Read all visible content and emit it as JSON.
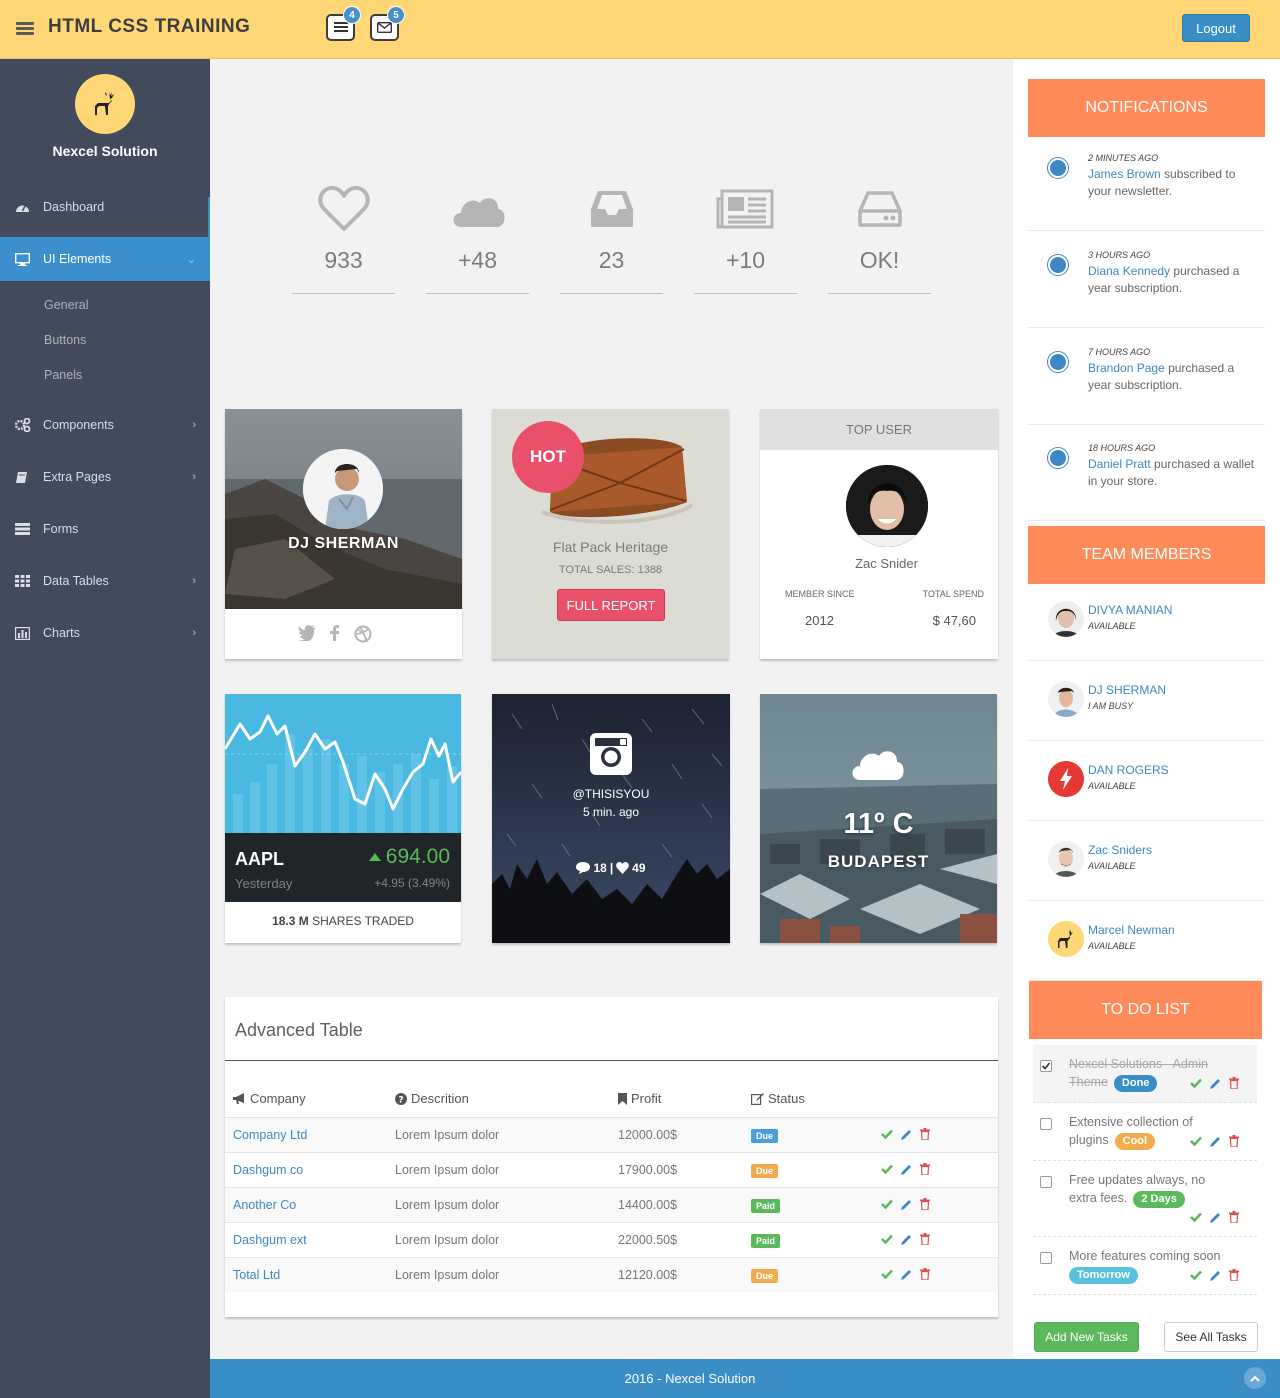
{
  "header": {
    "title": "HTML CSS TRAINING",
    "tasks_badge": "4",
    "mail_badge": "5",
    "logout_label": "Logout"
  },
  "sidebar": {
    "profile_name": "Nexcel Solution",
    "items": [
      {
        "label": "Dashboard",
        "icon": "dashboard-icon"
      },
      {
        "label": "UI Elements",
        "icon": "desktop-icon"
      },
      {
        "label": "Components",
        "icon": "cogs-icon"
      },
      {
        "label": "Extra Pages",
        "icon": "book-icon"
      },
      {
        "label": "Forms",
        "icon": "tasks-icon"
      },
      {
        "label": "Data Tables",
        "icon": "table-icon"
      },
      {
        "label": "Charts",
        "icon": "bar-chart-icon"
      }
    ],
    "subitems": [
      "General",
      "Buttons",
      "Panels"
    ]
  },
  "stats": [
    {
      "icon": "heart-icon",
      "value": "933"
    },
    {
      "icon": "cloud-icon",
      "value": "+48"
    },
    {
      "icon": "inbox-icon",
      "value": "23"
    },
    {
      "icon": "newspaper-icon",
      "value": "+10"
    },
    {
      "icon": "hdd-icon",
      "value": "OK!"
    }
  ],
  "profile_card": {
    "name": "DJ SHERMAN"
  },
  "product_card": {
    "badge": "HOT",
    "title": "Flat Pack Heritage",
    "sales": "TOTAL SALES: 1388",
    "button": "FULL REPORT"
  },
  "top_user": {
    "header": "TOP USER",
    "name": "Zac Snider",
    "member_since_label": "MEMBER SINCE",
    "member_since": "2012",
    "total_spend_label": "TOTAL SPEND",
    "total_spend": "$ 47,60"
  },
  "stock": {
    "symbol": "AAPL",
    "price": "694.00",
    "period": "Yesterday",
    "change": "+4.95 (3.49%)",
    "shares_value": "18.3 M",
    "shares_label": "SHARES TRADED"
  },
  "instagram": {
    "handle": "@THISISYOU",
    "time": "5 min. ago",
    "comments": "18",
    "likes": "49"
  },
  "weather": {
    "temp": "11º C",
    "city": "BUDAPEST"
  },
  "table": {
    "title": "Advanced Table",
    "headers": [
      "Company",
      "Descrition",
      "Profit",
      "Status"
    ],
    "rows": [
      {
        "company": "Company Ltd",
        "desc": "Lorem Ipsum dolor",
        "profit": "12000.00$",
        "status": "Due"
      },
      {
        "company": "Dashgum co",
        "desc": "Lorem Ipsum dolor",
        "profit": "17900.00$",
        "status": "Due"
      },
      {
        "company": "Another Co",
        "desc": "Lorem Ipsum dolor",
        "profit": "14400.00$",
        "status": "Paid"
      },
      {
        "company": "Dashgum ext",
        "desc": "Lorem Ipsum dolor",
        "profit": "22000.50$",
        "status": "Paid"
      },
      {
        "company": "Total Ltd",
        "desc": "Lorem Ipsum dolor",
        "profit": "12120.00$",
        "status": "Due"
      }
    ]
  },
  "notifications": {
    "title": "NOTIFICATIONS",
    "items": [
      {
        "time": "2 MINUTES AGO",
        "who": "James Brown",
        "text": "subscribed to your newsletter."
      },
      {
        "time": "3 HOURS AGO",
        "who": "Diana Kennedy",
        "text": "purchased a year subscription."
      },
      {
        "time": "7 HOURS AGO",
        "who": "Brandon Page",
        "text": "purchased a year subscription."
      },
      {
        "time": "18 HOURS AGO",
        "who": "Daniel Pratt",
        "text": "purchased a wallet in your store."
      }
    ]
  },
  "team": {
    "title": "TEAM MEMBERS",
    "members": [
      {
        "name": "DIVYA MANIAN",
        "status": "AVAILABLE"
      },
      {
        "name": "DJ SHERMAN",
        "status": "I AM BUSY"
      },
      {
        "name": "DAN ROGERS",
        "status": "AVAILABLE"
      },
      {
        "name": "Zac Sniders",
        "status": "AVAILABLE"
      },
      {
        "name": "Marcel Newman",
        "status": "AVAILABLE"
      }
    ]
  },
  "todo": {
    "title": "TO DO LIST",
    "items": [
      {
        "text": "Nexcel Solutions - Admin Theme",
        "tag": "Done",
        "done": true
      },
      {
        "text": "Extensive collection of plugins",
        "tag": "Cool",
        "done": false
      },
      {
        "text": "Free updates always, no extra fees.",
        "tag": "2 Days",
        "done": false
      },
      {
        "text": "More features coming soon",
        "tag": "Tomorrow",
        "done": false
      }
    ],
    "add_label": "Add New Tasks",
    "see_all_label": "See All Tasks"
  },
  "footer": {
    "text": "2016 - Nexcel Solution"
  }
}
